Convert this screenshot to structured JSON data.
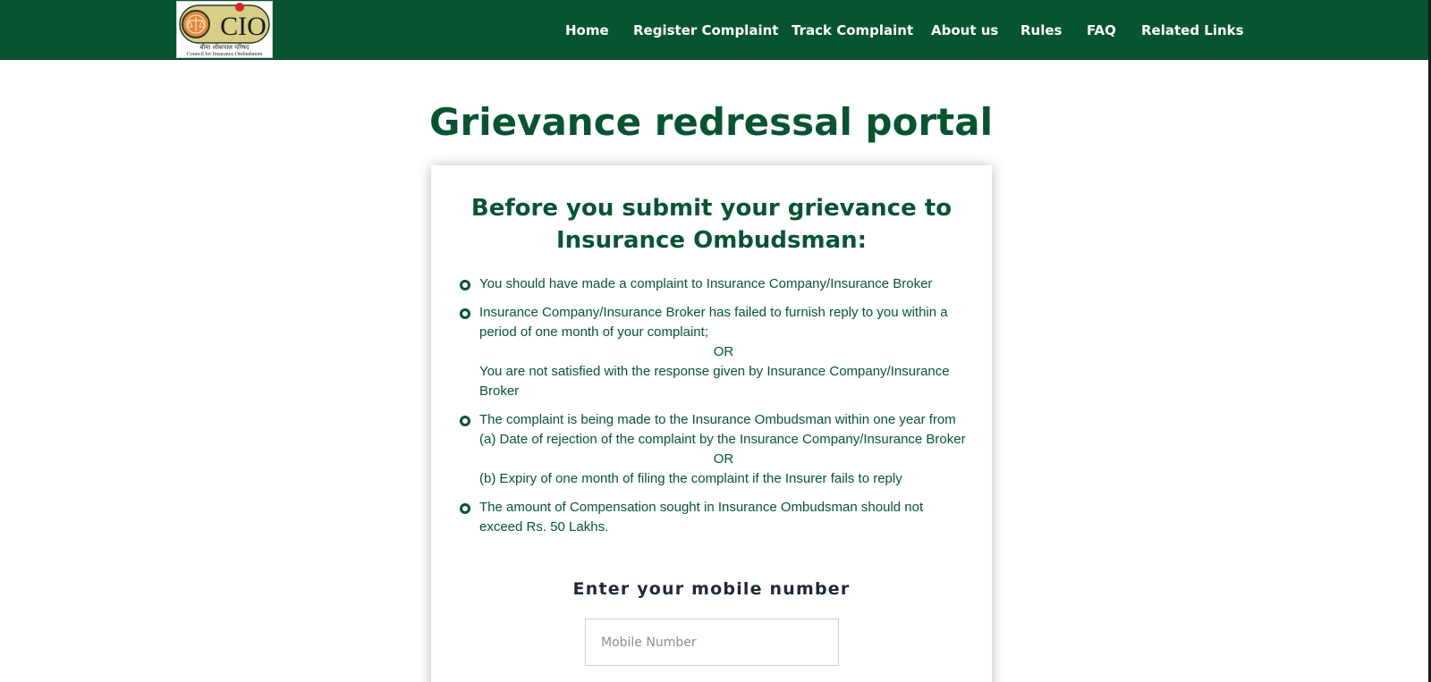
{
  "header": {
    "logo": {
      "text": "CIO",
      "hindi_text": "बीमा लोकपाल परिषद",
      "subtitle": "Council for Insurance Ombudsmen"
    },
    "nav": [
      {
        "label": "Home"
      },
      {
        "label": "Register Complaint"
      },
      {
        "label": "Track Complaint"
      },
      {
        "label": "About us"
      },
      {
        "label": "Rules"
      },
      {
        "label": "FAQ"
      },
      {
        "label": "Related Links"
      }
    ]
  },
  "main": {
    "title": "Grievance redressal portal",
    "card": {
      "heading_line1": "Before you submit your grievance to",
      "heading_line2": "Insurance Ombudsman:",
      "rules": [
        {
          "lines": [
            "You should have made a complaint to Insurance Company/Insurance Broker"
          ]
        },
        {
          "lines": [
            "Insurance Company/Insurance Broker has failed to furnish reply to you within a period of one month of your complaint;",
            "OR",
            "You are not satisfied with the response given by Insurance Company/Insurance Broker"
          ]
        },
        {
          "lines": [
            "The complaint is being made to the Insurance Ombudsman within one year from",
            "(a) Date of rejection of the complaint by the Insurance Company/Insurance Broker",
            "OR",
            "(b) Expiry of one month of filing the complaint if the Insurer fails to reply"
          ]
        },
        {
          "lines": [
            "The amount of Compensation sought in Insurance Ombudsman should not exceed Rs. 50 Lakhs."
          ]
        }
      ],
      "mobile_label": "Enter your mobile number",
      "mobile_placeholder": "Mobile Number"
    }
  },
  "colors": {
    "brand_green": "#075530",
    "label_dark": "#1e2a3a"
  }
}
